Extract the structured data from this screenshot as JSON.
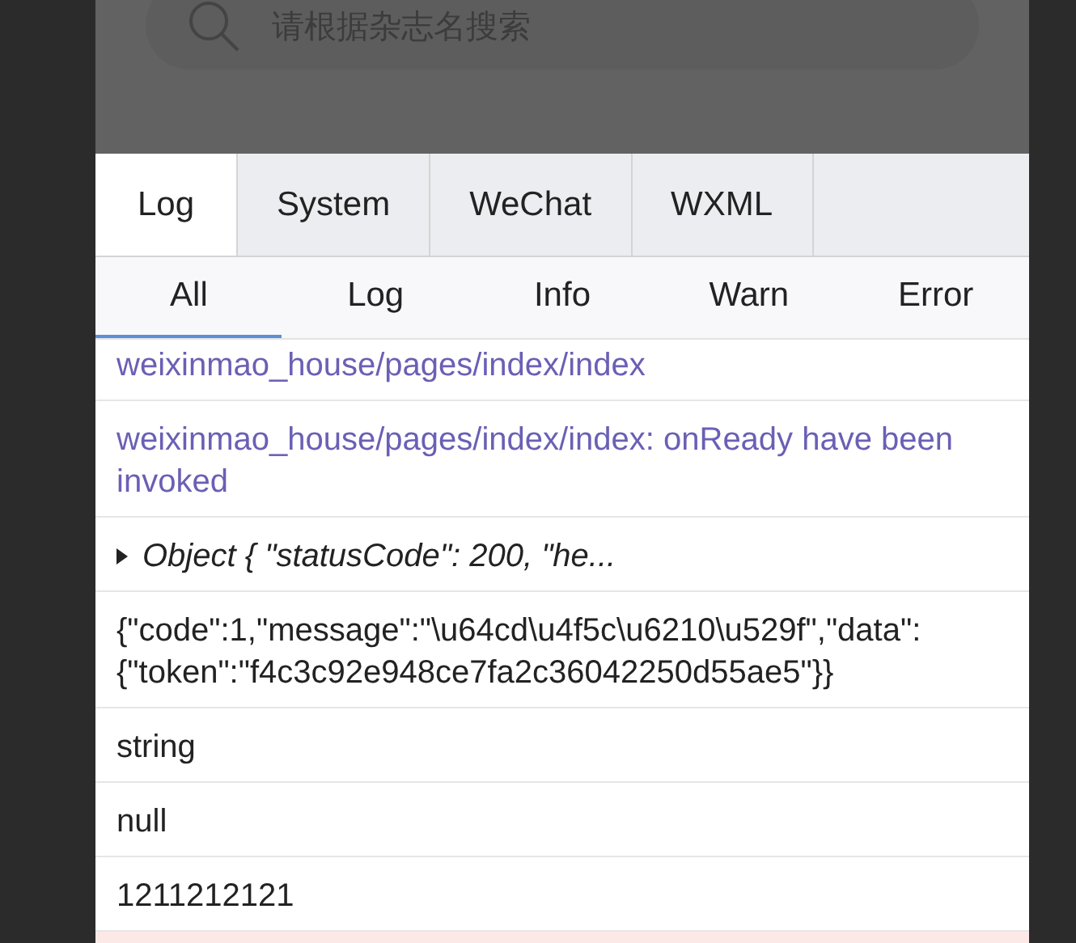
{
  "search": {
    "placeholder": "请根据杂志名搜索"
  },
  "tabs": [
    {
      "label": "Log",
      "selected": true
    },
    {
      "label": "System",
      "selected": false
    },
    {
      "label": "WeChat",
      "selected": false
    },
    {
      "label": "WXML",
      "selected": false
    }
  ],
  "filters": [
    {
      "label": "All",
      "selected": true
    },
    {
      "label": "Log",
      "selected": false
    },
    {
      "label": "Info",
      "selected": false
    },
    {
      "label": "Warn",
      "selected": false
    },
    {
      "label": "Error",
      "selected": false
    }
  ],
  "log_entries": [
    {
      "kind": "system",
      "text": "weixinmao_house/pages/index/index"
    },
    {
      "kind": "system",
      "text": "weixinmao_house/pages/index/index: onReady have been invoked"
    },
    {
      "kind": "object",
      "text": "Object { \"statusCode\": 200, \"he..."
    },
    {
      "kind": "text",
      "text": "{\"code\":1,\"message\":\"\\u64cd\\u4f5c\\u6210\\u529f\",\"data\":{\"token\":\"f4c3c92e948ce7fa2c36042250d55ae5\"}}"
    },
    {
      "kind": "text",
      "text": "string"
    },
    {
      "kind": "text",
      "text": "null"
    },
    {
      "kind": "text",
      "text": "1211212121"
    },
    {
      "kind": "error"
    }
  ]
}
